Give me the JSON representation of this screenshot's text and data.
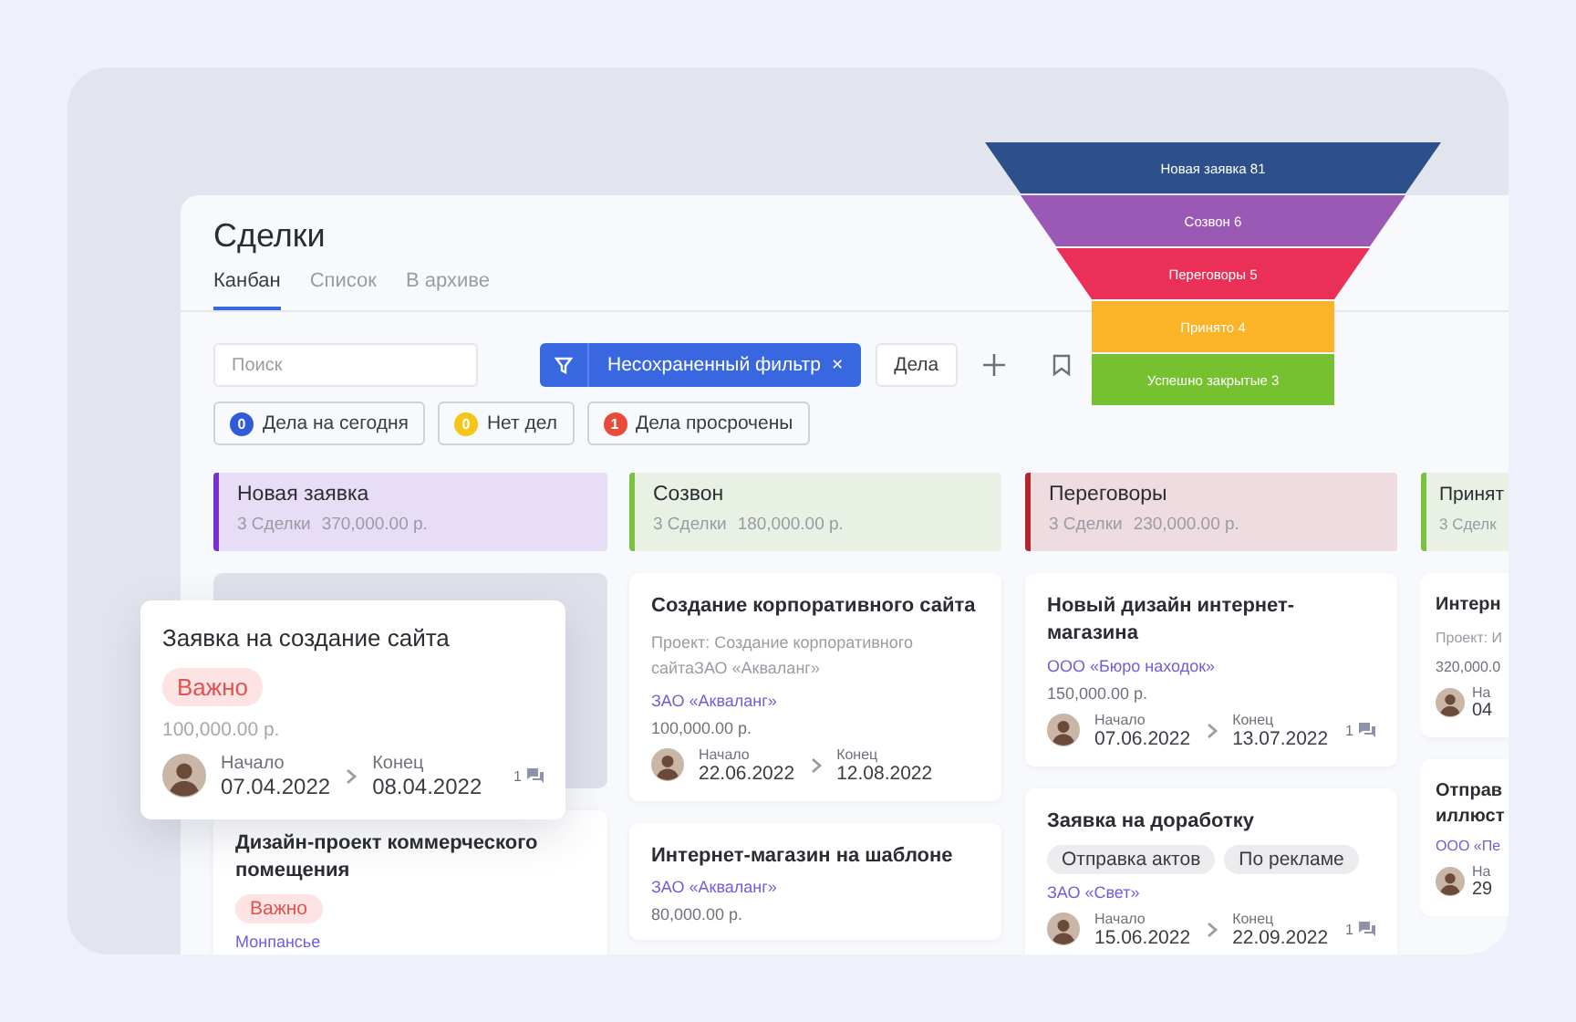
{
  "page": {
    "title": "Сделки"
  },
  "tabs": [
    {
      "label": "Канбан",
      "selected": true
    },
    {
      "label": "Список",
      "selected": false
    },
    {
      "label": "В архиве",
      "selected": false
    }
  ],
  "toolbar": {
    "search": {
      "placeholder": "Поиск"
    },
    "filter": {
      "label": "Несохраненный фильтр",
      "close": "×"
    },
    "tasks_button": "Дела"
  },
  "chips": [
    {
      "count": "0",
      "label": "Дела на сегодня",
      "color": "#2f5bd9"
    },
    {
      "count": "0",
      "label": "Нет дел",
      "color": "#f5c518"
    },
    {
      "count": "1",
      "label": "Дела просрочены",
      "color": "#e84b3c"
    }
  ],
  "columns": [
    {
      "name": "Новая заявка",
      "count": "3 Сделки",
      "sum": "370,000.00 р.",
      "color": "#7a2fd3",
      "cards": [
        {
          "kind": "placeholder"
        },
        {
          "kind": "deal",
          "title": "Дизайн-проект коммерческого помещения",
          "tags": [
            {
              "text": "Важно",
              "kind": "important"
            }
          ],
          "company": "Монпансье"
        }
      ]
    },
    {
      "name": "Созвон",
      "count": "3 Сделки",
      "sum": "180,000.00 р.",
      "color": "#7cc242",
      "cards": [
        {
          "kind": "deal",
          "title": "Создание корпоративного сайта",
          "project": "Проект: Создание корпоративного сайтаЗАО «Акваланг»",
          "company": "ЗАО «Акваланг»",
          "amount": "100,000.00 р.",
          "timeline": {
            "start_label": "Начало",
            "start": "22.06.2022",
            "end_label": "Конец",
            "end": "12.08.2022"
          }
        },
        {
          "kind": "deal",
          "title": "Интернет-магазин на шаблоне",
          "company": "ЗАО «Акваланг»",
          "amount": "80,000.00 р."
        }
      ]
    },
    {
      "name": "Переговоры",
      "count": "3 Сделки",
      "sum": "230,000.00 р.",
      "color": "#b3262f",
      "cards": [
        {
          "kind": "deal",
          "title": "Новый дизайн интернет-магазина",
          "company": "ООО «Бюро находок»",
          "amount": "150,000.00 р.",
          "timeline": {
            "start_label": "Начало",
            "start": "07.06.2022",
            "end_label": "Конец",
            "end": "13.07.2022",
            "comments": "1"
          }
        },
        {
          "kind": "deal",
          "title": "Заявка на доработку",
          "tags": [
            {
              "text": "Отправка актов",
              "kind": "plain"
            },
            {
              "text": "По рекламе",
              "kind": "plain"
            }
          ],
          "company": "ЗАО «Свет»",
          "timeline": {
            "start_label": "Начало",
            "start": "15.06.2022",
            "end_label": "Конец",
            "end": "22.09.2022",
            "comments": "1"
          }
        }
      ]
    },
    {
      "name": "Принят",
      "count": "3 Сделк",
      "color": "#7cc242",
      "cards": [
        {
          "kind": "deal",
          "title": "Интерн",
          "project": "Проект: И",
          "amount": "320,000.0",
          "timeline": {
            "start_label": "На",
            "start": "04"
          }
        },
        {
          "kind": "deal",
          "title": "Отправ иллюст",
          "company": "ООО «Пе",
          "timeline": {
            "start_label": "На",
            "start": "29"
          }
        }
      ]
    }
  ],
  "drag_card": {
    "title": "Заявка на создание сайта",
    "tags": [
      {
        "text": "Важно",
        "kind": "important"
      }
    ],
    "amount": "100,000.00 р.",
    "timeline": {
      "start_label": "Начало",
      "start": "07.04.2022",
      "end_label": "Конец",
      "end": "08.04.2022",
      "comments": "1"
    }
  },
  "funnel": [
    {
      "label": "Новая заявка",
      "count": "81",
      "color": "#2d4f8a"
    },
    {
      "label": "Созвон",
      "count": "6",
      "color": "#9b59b6"
    },
    {
      "label": "Переговоры",
      "count": "5",
      "color": "#ea3056"
    },
    {
      "label": "Принято",
      "count": "4",
      "color": "#fbb327"
    },
    {
      "label": "Успешно закрытые",
      "count": "3",
      "color": "#76c12f"
    }
  ]
}
